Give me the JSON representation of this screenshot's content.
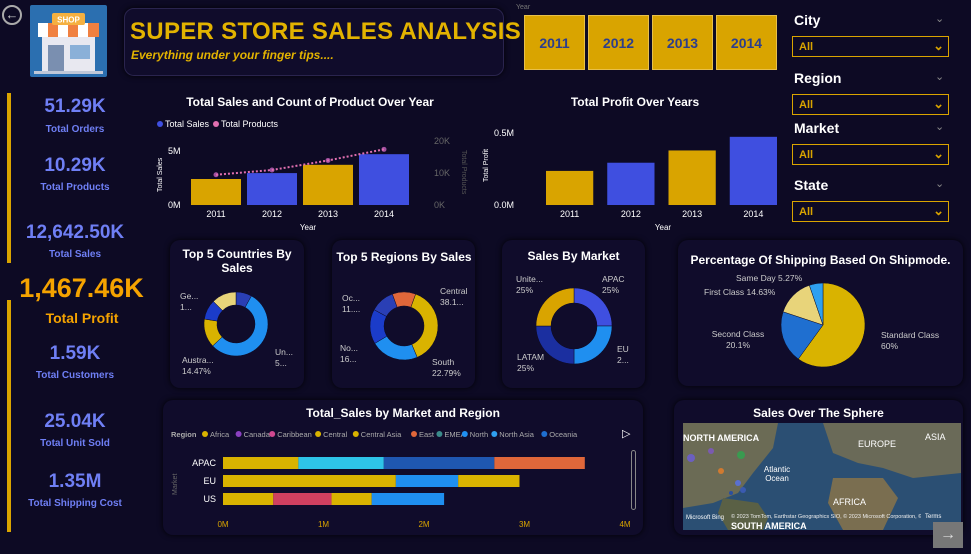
{
  "header": {
    "title": "SUPER STORE SALES ANALYSIS",
    "subtitle": "Everything under your finger tips....",
    "logo_text": "SHOP",
    "back_icon": "arrow-left-icon"
  },
  "year_filter": {
    "label": "Year",
    "years": [
      "2011",
      "2012",
      "2013",
      "2014"
    ]
  },
  "slicers": [
    {
      "label": "City",
      "value": "All"
    },
    {
      "label": "Region",
      "value": "All"
    },
    {
      "label": "Market",
      "value": "All"
    },
    {
      "label": "State",
      "value": "All"
    }
  ],
  "kpis": {
    "total_orders": {
      "value": "51.29K",
      "label": "Total Orders"
    },
    "total_products": {
      "value": "10.29K",
      "label": "Total Products"
    },
    "total_sales": {
      "value": "12,642.50K",
      "label": "Total Sales"
    },
    "total_profit": {
      "value": "1,467.46K",
      "label": "Total Profit"
    },
    "total_customers": {
      "value": "1.59K",
      "label": "Total Customers"
    },
    "total_unit_sold": {
      "value": "25.04K",
      "label": "Total Unit Sold"
    },
    "total_shipping_cost": {
      "value": "1.35M",
      "label": "Total Shipping Cost"
    }
  },
  "colors": {
    "gold": "#d9a400",
    "blue": "#3f4fe0",
    "pink": "#e06fb0",
    "background": "#0d0a24"
  },
  "chart_data": [
    {
      "type": "bar",
      "title": "Total Sales and Count of Product Over Year",
      "categories": [
        "2011",
        "2012",
        "2013",
        "2014"
      ],
      "series": [
        {
          "name": "Total Sales",
          "values": [
            2.2,
            2.7,
            3.4,
            4.3
          ]
        },
        {
          "name": "Total Products",
          "values": [
            9500,
            11000,
            14000,
            17500
          ]
        }
      ],
      "xlabel": "Year",
      "ylabel": "Total Sales",
      "y2label": "Total Products",
      "yticks": [
        "0M",
        "5M"
      ],
      "y2ticks": [
        "0K",
        "10K",
        "20K"
      ],
      "ylim": [
        0,
        5.5
      ],
      "y2lim": [
        0,
        22000
      ],
      "legend": "top-left"
    },
    {
      "type": "bar",
      "title": "Total Profit Over Years",
      "categories": [
        "2011",
        "2012",
        "2013",
        "2014"
      ],
      "values": [
        0.25,
        0.31,
        0.4,
        0.5
      ],
      "xlabel": "Year",
      "ylabel": "Total Profit",
      "yticks": [
        "0.0M",
        "0.5M"
      ],
      "ylim": [
        0,
        0.55
      ]
    },
    {
      "type": "pie",
      "title": "Top 5 Countries By Sales",
      "donut": true,
      "labels": [
        {
          "name": "Ge...",
          "value": "1..."
        },
        {
          "name": "Un...",
          "value": "5..."
        },
        {
          "name": "Austra...",
          "value": "14.47%"
        }
      ],
      "slices": [
        {
          "pct": 8,
          "color": "#2a3fb5"
        },
        {
          "pct": 55,
          "color": "#1f8ff0"
        },
        {
          "pct": 14.47,
          "color": "#d9b300"
        },
        {
          "pct": 10,
          "color": "#1b3cc9"
        },
        {
          "pct": 12.53,
          "color": "#e8d47a"
        }
      ]
    },
    {
      "type": "pie",
      "title": "Top 5 Regions By Sales",
      "donut": true,
      "labels": [
        {
          "name": "Central",
          "value": "38.1..."
        },
        {
          "name": "South",
          "value": "22.79%"
        },
        {
          "name": "No...",
          "value": "16..."
        },
        {
          "name": "Oc...",
          "value": "11...."
        }
      ],
      "slices": [
        {
          "pct": 38.1,
          "color": "#d9b300"
        },
        {
          "pct": 22.79,
          "color": "#1f8ff0"
        },
        {
          "pct": 16.5,
          "color": "#1b3cc9"
        },
        {
          "pct": 11.5,
          "color": "#2a3fb5"
        },
        {
          "pct": 11.11,
          "color": "#e0673a"
        }
      ]
    },
    {
      "type": "pie",
      "title": "Sales By Market",
      "donut": true,
      "labels": [
        {
          "name": "APAC",
          "value": "25%"
        },
        {
          "name": "EU",
          "value": "2..."
        },
        {
          "name": "LATAM",
          "value": "25%"
        },
        {
          "name": "Unite...",
          "value": "25%"
        }
      ],
      "slices": [
        {
          "pct": 25,
          "color": "#3f4fe0"
        },
        {
          "pct": 25,
          "color": "#1f8ff0"
        },
        {
          "pct": 25,
          "color": "#1b2fa0"
        },
        {
          "pct": 25,
          "color": "#d9a400"
        }
      ]
    },
    {
      "type": "pie",
      "title": "Percentage Of Shipping Based On Shipmode.",
      "labels": [
        {
          "name": "Standard Class",
          "value": "60%"
        },
        {
          "name": "Second Class",
          "value": "20.1%"
        },
        {
          "name": "First Class",
          "value": "14.63%"
        },
        {
          "name": "Same Day",
          "value": "5.27%"
        }
      ],
      "slices": [
        {
          "pct": 60,
          "color": "#d9b300"
        },
        {
          "pct": 20.1,
          "color": "#1f6fd0"
        },
        {
          "pct": 14.63,
          "color": "#e8d47a"
        },
        {
          "pct": 5.27,
          "color": "#2fa0f0"
        }
      ]
    },
    {
      "type": "bar",
      "orientation": "horizontal",
      "stacked": true,
      "title": "Total_Sales by Market and Region",
      "legend_title": "Region",
      "legend": [
        "Africa",
        "Canada",
        "Caribbean",
        "Central",
        "Central Asia",
        "East",
        "EMEA",
        "North",
        "North Asia",
        "Oceania"
      ],
      "legend_colors": [
        "#d9b300",
        "#8a40c0",
        "#d04890",
        "#d9b300",
        "#d9b300",
        "#e0673a",
        "#3a8a8a",
        "#1f8ff0",
        "#2fa0f0",
        "#1f6fd0"
      ],
      "categories": [
        "APAC",
        "EU",
        "US"
      ],
      "ylabel": "Market",
      "xticks": [
        "0M",
        "1M",
        "2M",
        "3M",
        "4M"
      ],
      "xlim": [
        0,
        4
      ],
      "series": [
        {
          "category": "APAC",
          "segments": [
            {
              "value": 0.75,
              "color": "#d9b300"
            },
            {
              "value": 0.85,
              "color": "#2ec4e8"
            },
            {
              "value": 1.1,
              "color": "#1f57b0"
            },
            {
              "value": 0.9,
              "color": "#e0673a"
            }
          ]
        },
        {
          "category": "EU",
          "segments": [
            {
              "value": 1.72,
              "color": "#d9b300"
            },
            {
              "value": 0.62,
              "color": "#1f8ff0"
            },
            {
              "value": 0.61,
              "color": "#d9b300"
            }
          ]
        },
        {
          "category": "US",
          "segments": [
            {
              "value": 0.5,
              "color": "#d9b300"
            },
            {
              "value": 0.58,
              "color": "#d04060"
            },
            {
              "value": 0.4,
              "color": "#d9b300"
            },
            {
              "value": 0.72,
              "color": "#1f8ff0"
            }
          ]
        }
      ]
    }
  ],
  "map": {
    "title": "Sales Over The Sphere",
    "labels": [
      "NORTH AMERICA",
      "EUROPE",
      "ASIA",
      "Atlantic Ocean",
      "AFRICA",
      "SOUTH AMERICA"
    ],
    "attribution": "© 2023 TomTom, Earthstar Geographics SIO, © 2023 Microsoft Corporation, © OpenStreetMap",
    "terms": "Terms",
    "microsoft": "Microsoft Bing"
  }
}
